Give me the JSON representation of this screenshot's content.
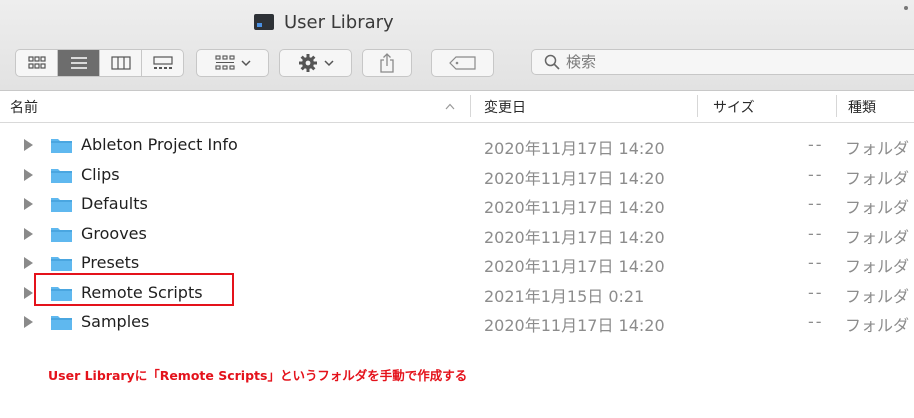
{
  "window": {
    "title": "User Library"
  },
  "toolbar": {
    "view_buttons": [
      {
        "name": "icon-view-icon"
      },
      {
        "name": "list-view-icon"
      },
      {
        "name": "column-view-icon"
      },
      {
        "name": "gallery-view-icon"
      }
    ],
    "active_view": "list",
    "group_icon": "group-by-icon",
    "action_icon": "gear-icon",
    "share_icon": "share-icon",
    "tag_icon": "tag-icon"
  },
  "search": {
    "placeholder": "検索"
  },
  "columns": {
    "name": "名前",
    "date": "変更日",
    "size": "サイズ",
    "kind": "種類",
    "sort_indicator": "^"
  },
  "rows": [
    {
      "name": "Ableton Project Info",
      "date": "2020年11月17日 14:20",
      "size": "--",
      "kind": "フォルダ"
    },
    {
      "name": "Clips",
      "date": "2020年11月17日 14:20",
      "size": "--",
      "kind": "フォルダ"
    },
    {
      "name": "Defaults",
      "date": "2020年11月17日 14:20",
      "size": "--",
      "kind": "フォルダ"
    },
    {
      "name": "Grooves",
      "date": "2020年11月17日 14:20",
      "size": "--",
      "kind": "フォルダ"
    },
    {
      "name": "Presets",
      "date": "2020年11月17日 14:20",
      "size": "--",
      "kind": "フォルダ"
    },
    {
      "name": "Remote Scripts",
      "date": "2021年1月15日 0:21",
      "size": "--",
      "kind": "フォルダ"
    },
    {
      "name": "Samples",
      "date": "2020年11月17日 14:20",
      "size": "--",
      "kind": "フォルダ"
    }
  ],
  "annotation": {
    "text": "User Libraryに「Remote Scripts」というフォルダを手動で作成する",
    "color": "#e4121b"
  },
  "colors": {
    "folder": "#5fb8ef",
    "folder_tab": "#4aa6e0",
    "active_segment": "#6d6d6d"
  }
}
